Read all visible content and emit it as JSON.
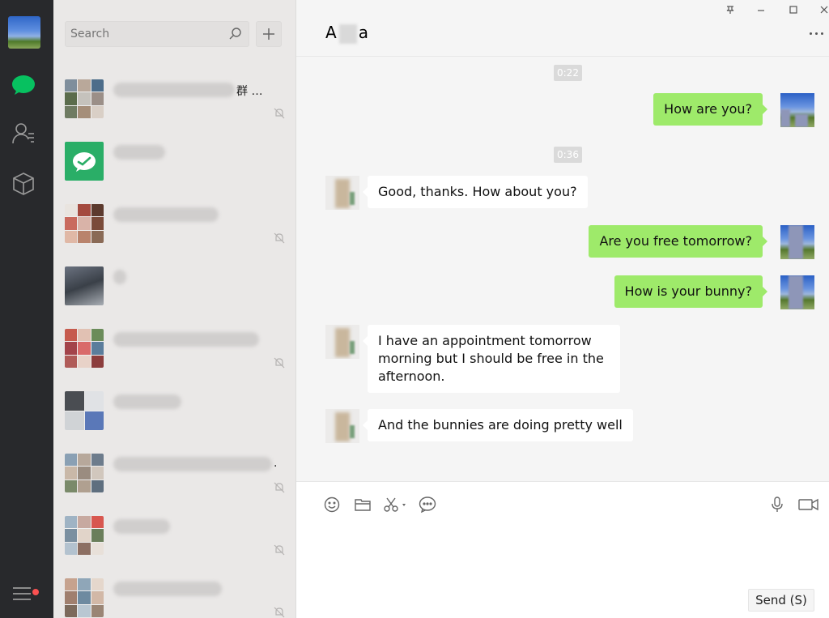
{
  "app": {
    "window_controls": {
      "pin": "pin-icon",
      "minimize": "minimize-icon",
      "maximize": "maximize-icon",
      "close": "close-icon"
    }
  },
  "rail": {
    "items": [
      {
        "name": "chats-icon",
        "active": true
      },
      {
        "name": "contacts-icon",
        "active": false
      },
      {
        "name": "favorites-icon",
        "active": false
      }
    ],
    "menu_icon": "menu-icon",
    "notification_color": "#fa5151"
  },
  "list": {
    "search_placeholder": "Search",
    "add_icon": "plus-icon",
    "conversations": [
      {
        "visible_name": "群 …",
        "muted": true
      },
      {
        "visible_name": "",
        "muted": false
      },
      {
        "visible_name": "",
        "muted": true
      },
      {
        "visible_name": "",
        "muted": false
      },
      {
        "visible_name": "",
        "muted": true
      },
      {
        "visible_name": "",
        "muted": false
      },
      {
        "visible_name": ".",
        "muted": true
      },
      {
        "visible_name": "",
        "muted": true
      },
      {
        "visible_name": "",
        "muted": true
      }
    ]
  },
  "chat": {
    "title_start": "A",
    "title_end": "a",
    "timestamps": [
      "0:22",
      "0:36"
    ],
    "messages": [
      {
        "from": "me",
        "text": "How are you?"
      },
      {
        "from": "her",
        "text": "Good, thanks. How about you?"
      },
      {
        "from": "me",
        "text": "Are you free tomorrow?"
      },
      {
        "from": "me",
        "text": "How is your bunny?"
      },
      {
        "from": "her",
        "text": "I have an appointment tomorrow morning but I should be free in the afternoon."
      },
      {
        "from": "her",
        "text": "And the bunnies are doing pretty well"
      }
    ],
    "toolbar": [
      "emoji-icon",
      "folder-icon",
      "scissors-icon",
      "chat-history-icon",
      "microphone-icon",
      "video-call-icon"
    ],
    "send_label": "Send (S)"
  },
  "colors": {
    "rail_bg": "#28292c",
    "active_green": "#07c160",
    "my_bubble": "#9eea6a",
    "list_bg": "#eae8e7"
  }
}
